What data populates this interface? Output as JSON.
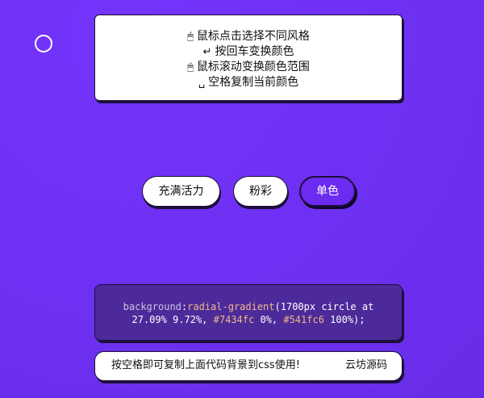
{
  "colors": {
    "background_start": "#7434fc",
    "background_end": "#541fc6",
    "accent": "#6b2bf0",
    "panel_border": "#1d0f3a",
    "code_panel": "#4c2a9a",
    "code_highlight": "#f1b985"
  },
  "instructions": {
    "items": [
      {
        "icon": "mouse-icon",
        "glyph": "🖱",
        "text": "鼠标点击选择不同风格"
      },
      {
        "icon": "enter-key-icon",
        "glyph": "↵",
        "text": "按回车变换颜色"
      },
      {
        "icon": "mouse-wheel-icon",
        "glyph": "🖱",
        "text": "鼠标滚动变换颜色范围"
      },
      {
        "icon": "space-key-icon",
        "glyph": "␣",
        "text": "空格复制当前颜色"
      }
    ]
  },
  "style_buttons": [
    {
      "label": "充满活力",
      "selected": false
    },
    {
      "label": "粉彩",
      "selected": false
    },
    {
      "label": "单色",
      "selected": true
    }
  ],
  "code": {
    "property": "background",
    "colon": ":",
    "function": "radial-gradient",
    "args_line1": "(1700px circle at",
    "position": "27.09% 9.72%, ",
    "color1": "#7434fc",
    "stop1": " 0%, ",
    "color2": "#541fc6",
    "stop2": " 100%);"
  },
  "footer": {
    "hint": "按空格即可复制上面代码背景到css使用!",
    "link": "云坊源码"
  }
}
